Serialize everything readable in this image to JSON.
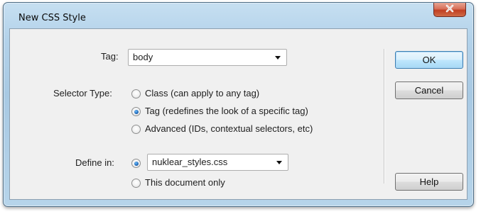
{
  "dialog": {
    "title": "New CSS Style"
  },
  "tag": {
    "label": "Tag:",
    "value": "body"
  },
  "selector_type": {
    "label": "Selector Type:",
    "options": [
      {
        "label": "Class (can apply to any tag)",
        "checked": false
      },
      {
        "label": "Tag (redefines the look of a specific tag)",
        "checked": true
      },
      {
        "label": "Advanced (IDs, contextual selectors, etc)",
        "checked": false
      }
    ]
  },
  "define_in": {
    "label": "Define in:",
    "file_option_checked": true,
    "file_value": "nuklear_styles.css",
    "document_only_label": "This document only",
    "document_only_checked": false
  },
  "buttons": {
    "ok": "OK",
    "cancel": "Cancel",
    "help": "Help"
  },
  "colors": {
    "title_bar": "#b3d2ea",
    "close_button": "#c9553a",
    "client_background": "#f0f0f0",
    "radio_selected": "#1e66b5"
  },
  "icons": {
    "close": "close-x-icon",
    "dropdown": "chevron-down-icon"
  }
}
